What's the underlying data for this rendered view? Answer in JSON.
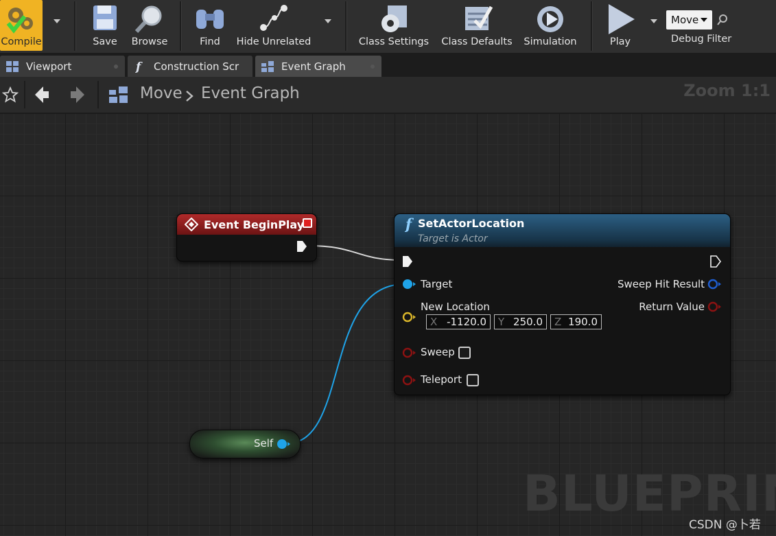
{
  "toolbar": {
    "compile": "Compile",
    "save": "Save",
    "browse": "Browse",
    "find": "Find",
    "hide_unrelated": "Hide Unrelated",
    "class_settings": "Class Settings",
    "class_defaults": "Class Defaults",
    "simulation": "Simulation",
    "play": "Play",
    "debug_object": "Move",
    "debug_filter": "Debug Filter"
  },
  "tabs": [
    {
      "label": "Viewport",
      "icon": "viewport-icon"
    },
    {
      "label": "Construction Scrip",
      "icon": "function-icon"
    },
    {
      "label": "Event Graph",
      "icon": "event-graph-icon",
      "active": true
    }
  ],
  "breadcrumb": {
    "blueprint": "Move",
    "graph": "Event Graph"
  },
  "zoom": "Zoom 1:1",
  "nodes": {
    "event": {
      "title": "Event BeginPlay"
    },
    "function": {
      "title": "SetActorLocation",
      "subtitle": "Target is Actor",
      "target": "Target",
      "new_location": "New Location",
      "x_axis": "X",
      "x": "-1120.0",
      "y_axis": "Y",
      "y": "250.0",
      "z_axis": "Z",
      "z": "190.0",
      "sweep": "Sweep",
      "teleport": "Teleport",
      "sweep_hit_result": "Sweep Hit Result",
      "return_value": "Return Value"
    },
    "self": {
      "label": "Self"
    }
  },
  "watermark": "BLUEPRINT",
  "credit": "CSDN @卜若",
  "colors": {
    "compile_bg": "#f0b323",
    "event_header": "#b02a2a",
    "function_header": "#2c5f84",
    "object_pin": "#1fa3e8",
    "vector_pin": "#d9b52a",
    "bool_pin": "#8c1212",
    "struct_pin": "#1f5ed2"
  }
}
